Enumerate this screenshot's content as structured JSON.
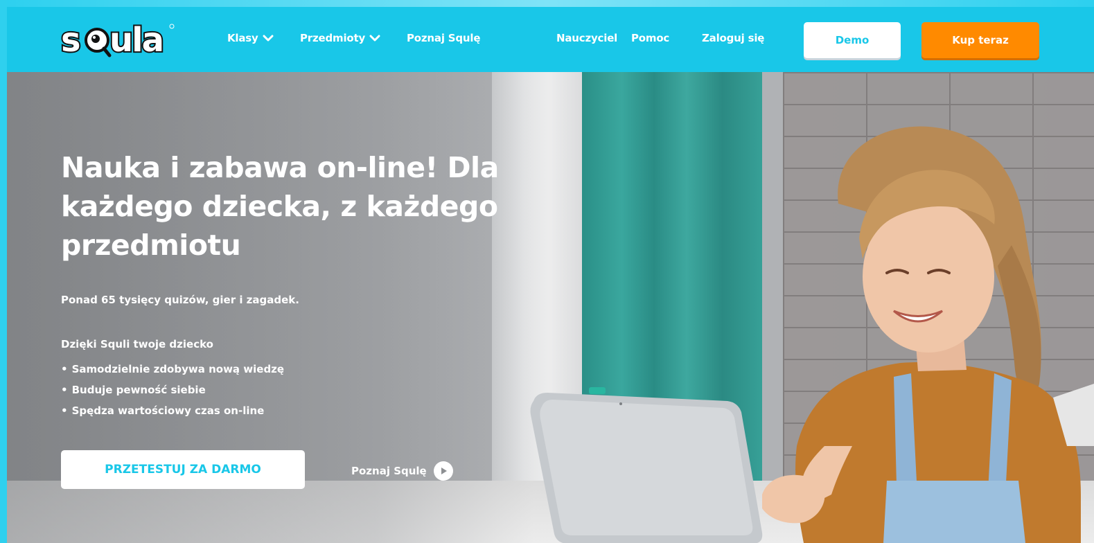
{
  "brand": {
    "logo_text": "sQula",
    "primary_color": "#19c7e8",
    "accent_color": "#ff8a00"
  },
  "nav": {
    "left_links": [
      {
        "label": "Klasy",
        "has_dropdown": true
      },
      {
        "label": "Przedmioty",
        "has_dropdown": true
      },
      {
        "label": "Poznaj Squlę",
        "has_dropdown": false
      }
    ],
    "right_links": [
      {
        "label": "Nauczyciel"
      },
      {
        "label": "Pomoc"
      },
      {
        "label": "Zaloguj się"
      }
    ],
    "demo_label": "Demo",
    "buy_label": "Kup teraz"
  },
  "hero": {
    "headline_lines": [
      "Nauka i zabawa on-line! Dla",
      "każdego dziecka, z każdego",
      "przedmiotu"
    ],
    "subline": "Ponad 65 tysięcy quizów, gier i zagadek.",
    "intro": "Dzięki Squli twoje dziecko",
    "bullets": [
      "Samodzielnie zdobywa nową wiedzę",
      "Buduje pewność siebie",
      "Spędza wartościowy czas on-line"
    ],
    "cta_label": "PRZETESTUJ ZA DARMO",
    "play_label": "Poznaj Squlę"
  }
}
